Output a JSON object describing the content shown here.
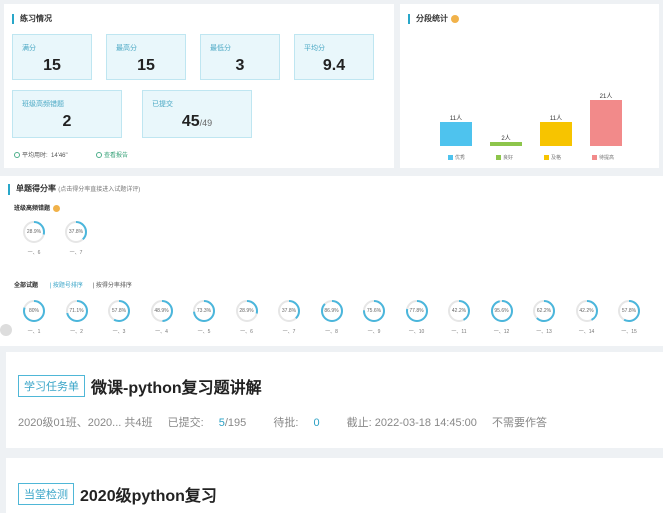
{
  "practice": {
    "title": "练习情况",
    "stats": [
      {
        "label": "满分",
        "value": "15"
      },
      {
        "label": "最高分",
        "value": "15"
      },
      {
        "label": "最低分",
        "value": "3"
      },
      {
        "label": "平均分",
        "value": "9.4"
      }
    ],
    "class_errors": {
      "label": "班级高频错题",
      "value": "2"
    },
    "submitted": {
      "label": "已提交",
      "value": "45",
      "total": "/49"
    },
    "avg_time_label": "平均用时:",
    "avg_time": "14'46\"",
    "view_report": "查看报告"
  },
  "segment": {
    "title": "分段统计",
    "bars": [
      {
        "label": "11人",
        "value": 11,
        "color": "#4ec3ee",
        "legend": "优秀"
      },
      {
        "label": "2人",
        "value": 2,
        "color": "#8dc54b",
        "legend": "良好"
      },
      {
        "label": "11人",
        "value": 11,
        "color": "#f7c400",
        "legend": "及格"
      },
      {
        "label": "21人",
        "value": 21,
        "color": "#f28a8a",
        "legend": "待提高"
      }
    ]
  },
  "scoring": {
    "title": "单题得分率",
    "hint": "(点击得分率直接进入试题详评)",
    "freq_title": "班级高频错题",
    "freq_rings": [
      {
        "pct": "28.9%",
        "value": 28.9,
        "caption": "一、6"
      },
      {
        "pct": "37.8%",
        "value": 37.8,
        "caption": "一、7"
      }
    ],
    "all_title": "全部试题",
    "sort_by_number": "按题号排序",
    "sort_by_rate": "按得分率排序",
    "rings": [
      {
        "pct": "80%",
        "value": 80,
        "caption": "一、1"
      },
      {
        "pct": "71.1%",
        "value": 71.1,
        "caption": "一、2"
      },
      {
        "pct": "57.8%",
        "value": 57.8,
        "caption": "一、3"
      },
      {
        "pct": "48.9%",
        "value": 48.9,
        "caption": "一、4"
      },
      {
        "pct": "73.3%",
        "value": 73.3,
        "caption": "一、5"
      },
      {
        "pct": "28.9%",
        "value": 28.9,
        "caption": "一、6"
      },
      {
        "pct": "37.8%",
        "value": 37.8,
        "caption": "一、7"
      },
      {
        "pct": "86.9%",
        "value": 86.9,
        "caption": "一、8"
      },
      {
        "pct": "75.6%",
        "value": 75.6,
        "caption": "一、9"
      },
      {
        "pct": "77.8%",
        "value": 77.8,
        "caption": "一、10"
      },
      {
        "pct": "42.2%",
        "value": 42.2,
        "caption": "一、11"
      },
      {
        "pct": "95.6%",
        "value": 95.6,
        "caption": "一、12"
      },
      {
        "pct": "62.2%",
        "value": 62.2,
        "caption": "一、13"
      },
      {
        "pct": "42.2%",
        "value": 42.2,
        "caption": "一、14"
      },
      {
        "pct": "57.8%",
        "value": 57.8,
        "caption": "一、15"
      }
    ],
    "ring_color": "#4ab6dc"
  },
  "task1": {
    "tag": "学习任务单",
    "title": "微课-python复习题讲解",
    "classes": "2020级01班、2020... 共4班",
    "submitted_label": "已提交:",
    "submitted": "5",
    "submitted_total": "/195",
    "pending_label": "待批:",
    "pending": "0",
    "deadline": "截止: 2022-03-18 14:45:00",
    "note": "不需要作答"
  },
  "task2": {
    "tag": "当堂检测",
    "title": "2020级python复习"
  }
}
